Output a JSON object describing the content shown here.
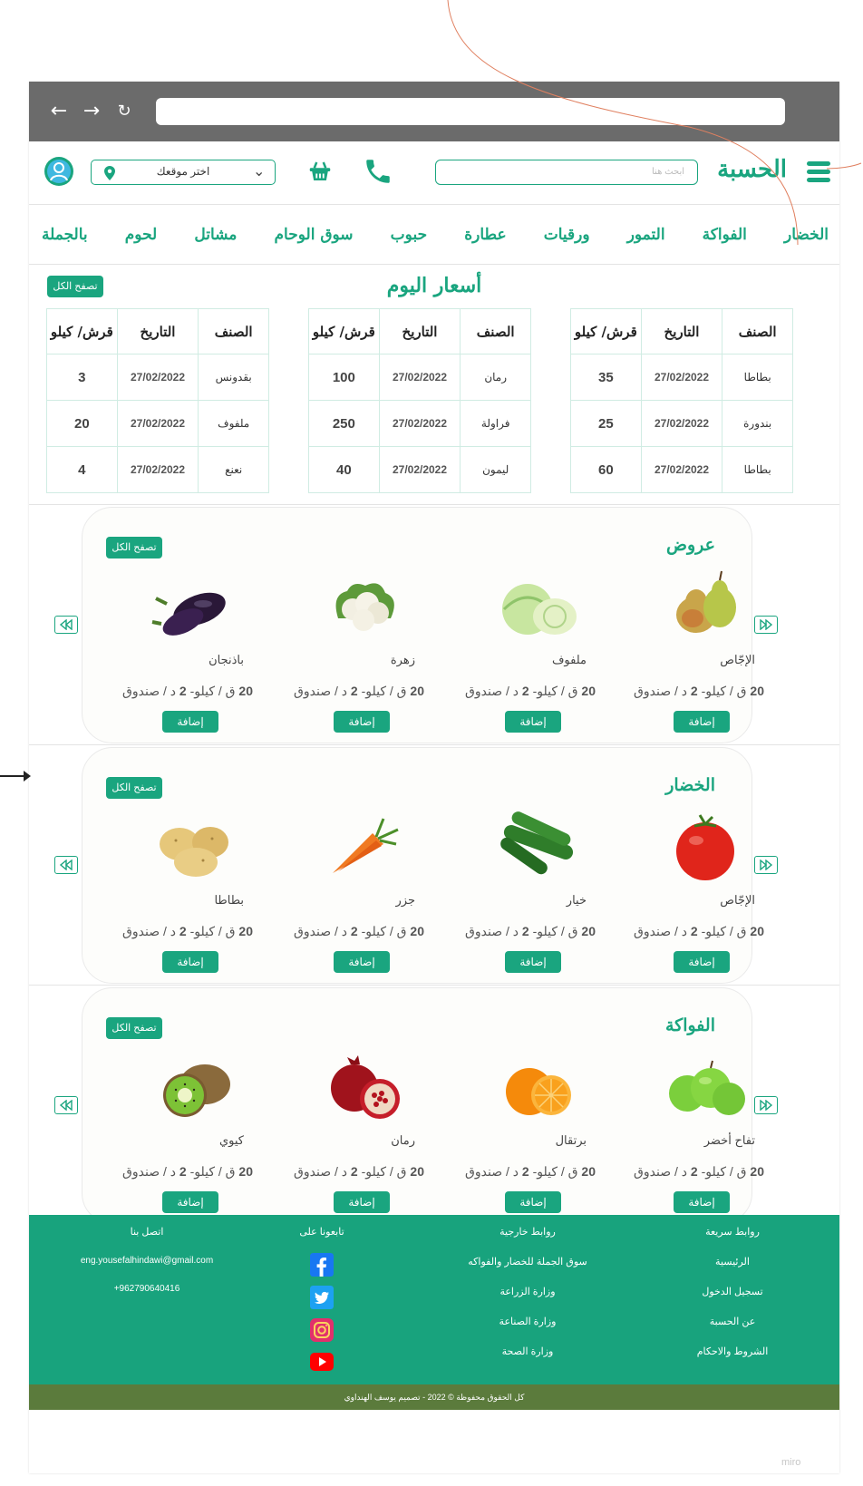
{
  "header": {
    "logo": "الحسبة",
    "search_placeholder": "ابحث هنا",
    "location_label": "اختر موقعك"
  },
  "categories": [
    "الخضار",
    "الفواكة",
    "التمور",
    "ورقيات",
    "عطارة",
    "حبوب",
    "سوق الوحام",
    "مشاتل",
    "لحوم",
    "بالجملة"
  ],
  "prices": {
    "title": "أسعار اليوم",
    "browse_all": "تصفح الكل",
    "columns": {
      "item": "الصنف",
      "date": "التاريخ",
      "price": "قرش/ كيلو"
    },
    "tables": [
      {
        "rows": [
          {
            "item": "بطاطا",
            "date": "27/02/2022",
            "price": "35"
          },
          {
            "item": "بندورة",
            "date": "27/02/2022",
            "price": "25"
          },
          {
            "item": "بطاطا",
            "date": "27/02/2022",
            "price": "60"
          }
        ]
      },
      {
        "rows": [
          {
            "item": "رمان",
            "date": "27/02/2022",
            "price": "100"
          },
          {
            "item": "فراولة",
            "date": "27/02/2022",
            "price": "250"
          },
          {
            "item": "ليمون",
            "date": "27/02/2022",
            "price": "40"
          }
        ]
      },
      {
        "rows": [
          {
            "item": "بقدونس",
            "date": "27/02/2022",
            "price": "3"
          },
          {
            "item": "ملفوف",
            "date": "27/02/2022",
            "price": "20"
          },
          {
            "item": "نعنع",
            "date": "27/02/2022",
            "price": "4"
          }
        ]
      }
    ]
  },
  "sections": [
    {
      "title": "عروض",
      "browse_all": "تصفح الكل",
      "products": [
        {
          "name": "الإجّاص",
          "price_num": "20",
          "price_mid": " ق / كيلو- ",
          "price_num2": "2",
          "price_end": " د / صندوق",
          "add": "إضافة",
          "icon": "pear-icon"
        },
        {
          "name": "ملفوف",
          "price_num": "20",
          "price_mid": " ق / كيلو- ",
          "price_num2": "2",
          "price_end": " د / صندوق",
          "add": "إضافة",
          "icon": "cabbage-icon"
        },
        {
          "name": "زهرة",
          "price_num": "20",
          "price_mid": " ق / كيلو- ",
          "price_num2": "2",
          "price_end": " د / صندوق",
          "add": "إضافة",
          "icon": "cauliflower-icon"
        },
        {
          "name": "باذنجان",
          "price_num": "20",
          "price_mid": " ق / كيلو- ",
          "price_num2": "2",
          "price_end": " د / صندوق",
          "add": "إضافة",
          "icon": "eggplant-icon"
        }
      ]
    },
    {
      "title": "الخضار",
      "browse_all": "تصفح الكل",
      "products": [
        {
          "name": "الإجّاص",
          "price_num": "20",
          "price_mid": " ق / كيلو- ",
          "price_num2": "2",
          "price_end": " د / صندوق",
          "add": "إضافة",
          "icon": "tomato-icon"
        },
        {
          "name": "خيار",
          "price_num": "20",
          "price_mid": " ق / كيلو- ",
          "price_num2": "2",
          "price_end": " د / صندوق",
          "add": "إضافة",
          "icon": "cucumber-icon"
        },
        {
          "name": "جزر",
          "price_num": "20",
          "price_mid": " ق / كيلو- ",
          "price_num2": "2",
          "price_end": " د / صندوق",
          "add": "إضافة",
          "icon": "carrot-icon"
        },
        {
          "name": "بطاطا",
          "price_num": "20",
          "price_mid": " ق / كيلو- ",
          "price_num2": "2",
          "price_end": " د / صندوق",
          "add": "إضافة",
          "icon": "potato-icon"
        }
      ]
    },
    {
      "title": "الفواكة",
      "browse_all": "تصفح الكل",
      "products": [
        {
          "name": "تفاح أخضر",
          "price_num": "20",
          "price_mid": " ق / كيلو- ",
          "price_num2": "2",
          "price_end": " د / صندوق",
          "add": "إضافة",
          "icon": "green-apple-icon"
        },
        {
          "name": "برتقال",
          "price_num": "20",
          "price_mid": " ق / كيلو- ",
          "price_num2": "2",
          "price_end": " د / صندوق",
          "add": "إضافة",
          "icon": "orange-icon"
        },
        {
          "name": "رمان",
          "price_num": "20",
          "price_mid": " ق / كيلو- ",
          "price_num2": "2",
          "price_end": " د / صندوق",
          "add": "إضافة",
          "icon": "pomegranate-icon"
        },
        {
          "name": "كيوي",
          "price_num": "20",
          "price_mid": " ق / كيلو- ",
          "price_num2": "2",
          "price_end": " د / صندوق",
          "add": "إضافة",
          "icon": "kiwi-icon"
        }
      ]
    }
  ],
  "footer": {
    "quick_links": {
      "title": "روابط سريعة",
      "items": [
        "الرئيسية",
        "تسجيل الدخول",
        "عن الحسبة",
        "الشروط والاحكام"
      ]
    },
    "external_links": {
      "title": "روابط خارجية",
      "items": [
        "سوق الجملة للخضار والفواكه",
        "وزارة الزراعة",
        "وزارة الصناعة",
        "وزارة الصحة"
      ]
    },
    "follow": {
      "title": "تابعونا على",
      "icons": [
        "facebook-icon",
        "twitter-icon",
        "instagram-icon",
        "youtube-icon"
      ]
    },
    "contact": {
      "title": "اتصل بنا",
      "email": "eng.yousefalhindawi@gmail.com",
      "phone": "+962790640416"
    },
    "copyright": "كل الحقوق محفوظة © 2022 - تصميم يوسف الهنداوي"
  },
  "watermark": "miro",
  "colors": {
    "accent": "#1aa57f",
    "footer": "#18a37d",
    "copyright_bar": "#5b7b3c",
    "chrome": "#6b6b6b"
  }
}
